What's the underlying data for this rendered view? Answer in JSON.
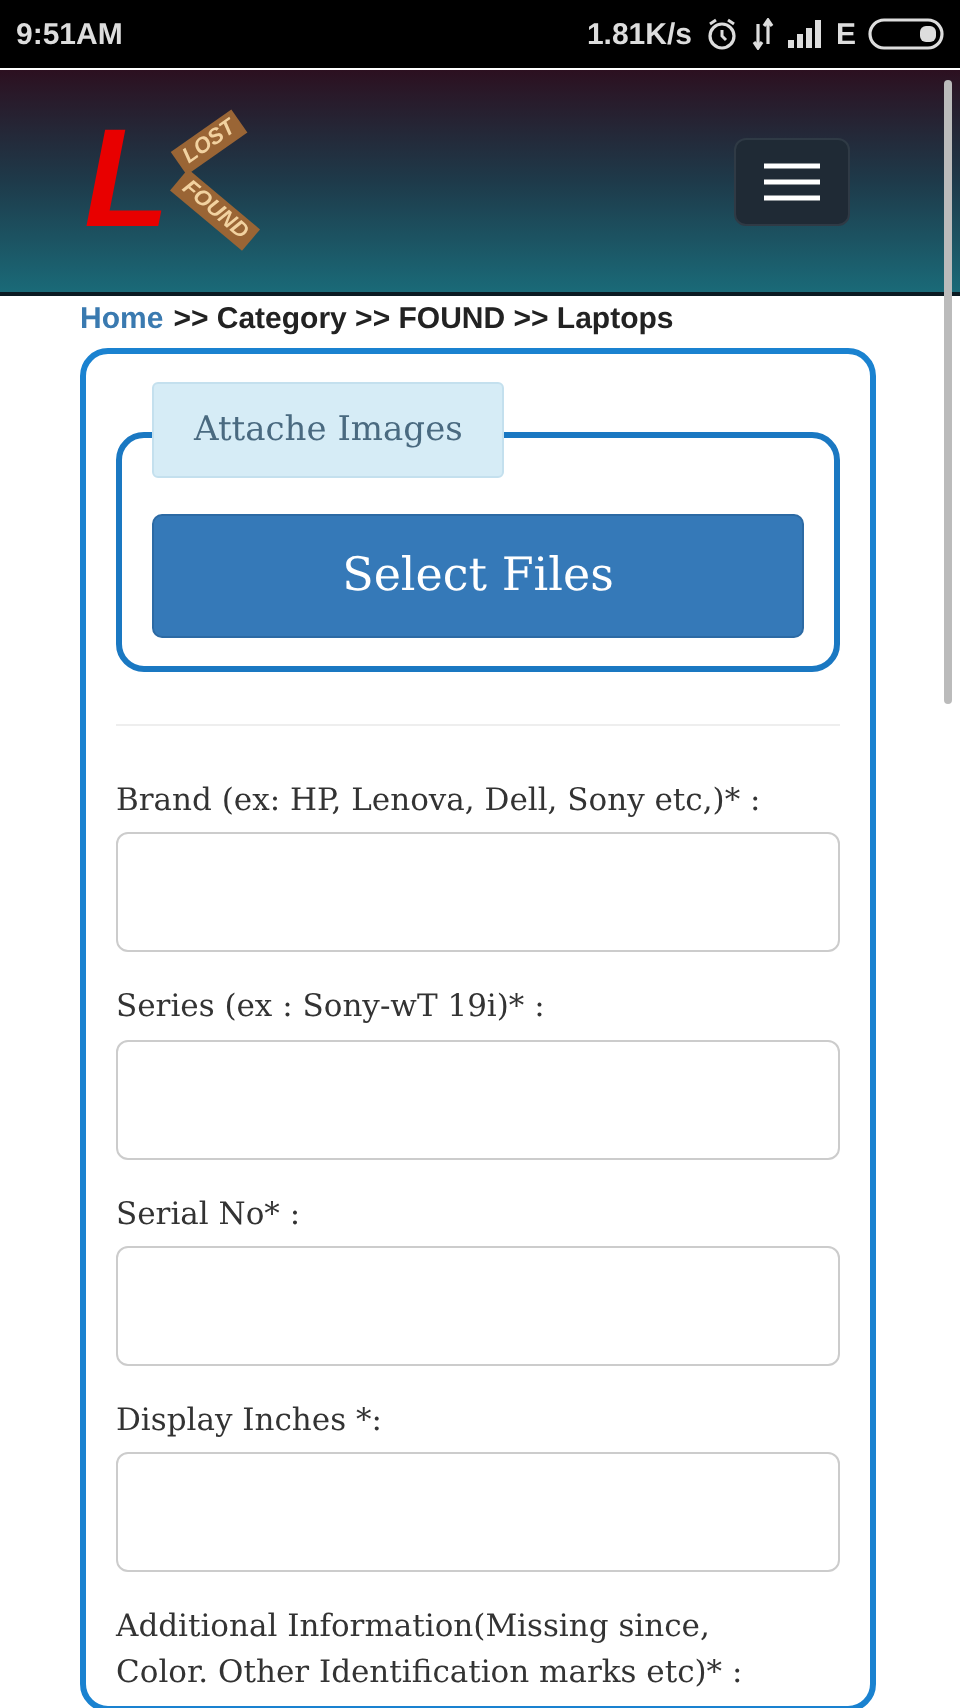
{
  "status_bar": {
    "time": "9:51AM",
    "speed": "1.81K/s",
    "network": "E"
  },
  "header": {
    "logo": {
      "letter": "L",
      "top_sign": "LOST",
      "bottom_sign": "FOUND"
    }
  },
  "breadcrumb": [
    {
      "label": "Home",
      "kind": "link"
    },
    {
      "label": ">> Category >> FOUND >> Laptops",
      "kind": "text"
    }
  ],
  "attach": {
    "legend": "Attache Images",
    "button": "Select Files"
  },
  "fields": [
    {
      "label": "Brand (ex: HP, Lenova, Dell, Sony etc,)* :"
    },
    {
      "label": "Series (ex : Sony-wT 19i)* :"
    },
    {
      "label": "Serial No* :"
    },
    {
      "label": "Display Inches *:"
    },
    {
      "label": "Additional Information(Missing since, Color. Other Identification marks etc)* :",
      "kind": "label_only"
    }
  ]
}
